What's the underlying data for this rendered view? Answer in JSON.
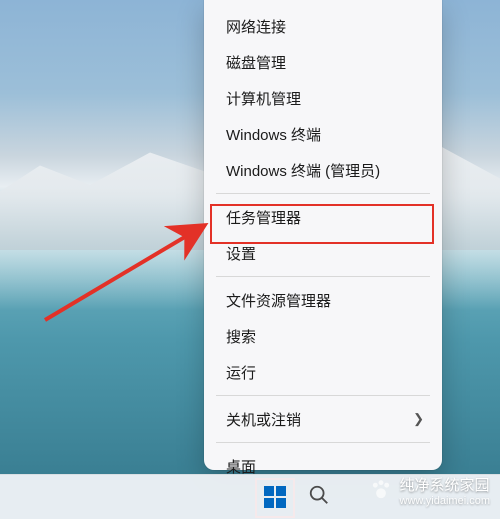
{
  "menu": {
    "items": [
      {
        "label": "网络连接"
      },
      {
        "label": "磁盘管理"
      },
      {
        "label": "计算机管理"
      },
      {
        "label": "Windows 终端"
      },
      {
        "label": "Windows 终端 (管理员)"
      }
    ],
    "items2": [
      {
        "label": "任务管理器"
      },
      {
        "label": "设置"
      }
    ],
    "items3": [
      {
        "label": "文件资源管理器"
      },
      {
        "label": "搜索"
      },
      {
        "label": "运行"
      }
    ],
    "items4": [
      {
        "label": "关机或注销",
        "submenu": true
      }
    ],
    "items5": [
      {
        "label": "桌面"
      }
    ]
  },
  "annotations": {
    "highlight_color": "#e33127",
    "arrow_color": "#e33127"
  },
  "watermark": {
    "title": "纯净系统家园",
    "url": "www.yidaimei.com"
  }
}
